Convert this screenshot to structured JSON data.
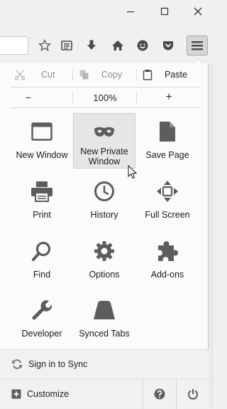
{
  "window": {
    "minimize_icon": "minimize-icon",
    "maximize_icon": "maximize-icon",
    "close_icon": "close-icon"
  },
  "toolbar": {
    "icons": [
      "bookmark-star-icon",
      "reading-list-icon",
      "download-icon",
      "home-icon",
      "hello-chat-icon",
      "pocket-icon",
      "hamburger-menu-icon"
    ]
  },
  "edit": {
    "cut": "Cut",
    "copy": "Copy",
    "paste": "Paste"
  },
  "zoom": {
    "minus": "−",
    "value": "100%",
    "plus": "+"
  },
  "grid": {
    "new_window": "New Window",
    "new_private_window": "New Private\nWindow",
    "save_page": "Save Page",
    "print": "Print",
    "history": "History",
    "full_screen": "Full Screen",
    "find": "Find",
    "options": "Options",
    "addons": "Add-ons",
    "developer": "Developer",
    "synced_tabs": "Synced Tabs"
  },
  "footer": {
    "sign_in": "Sign in to Sync",
    "customize": "Customize"
  },
  "colors": {
    "icon_gray": "#5d5d5d",
    "panel_bg": "#fbfbfb"
  }
}
